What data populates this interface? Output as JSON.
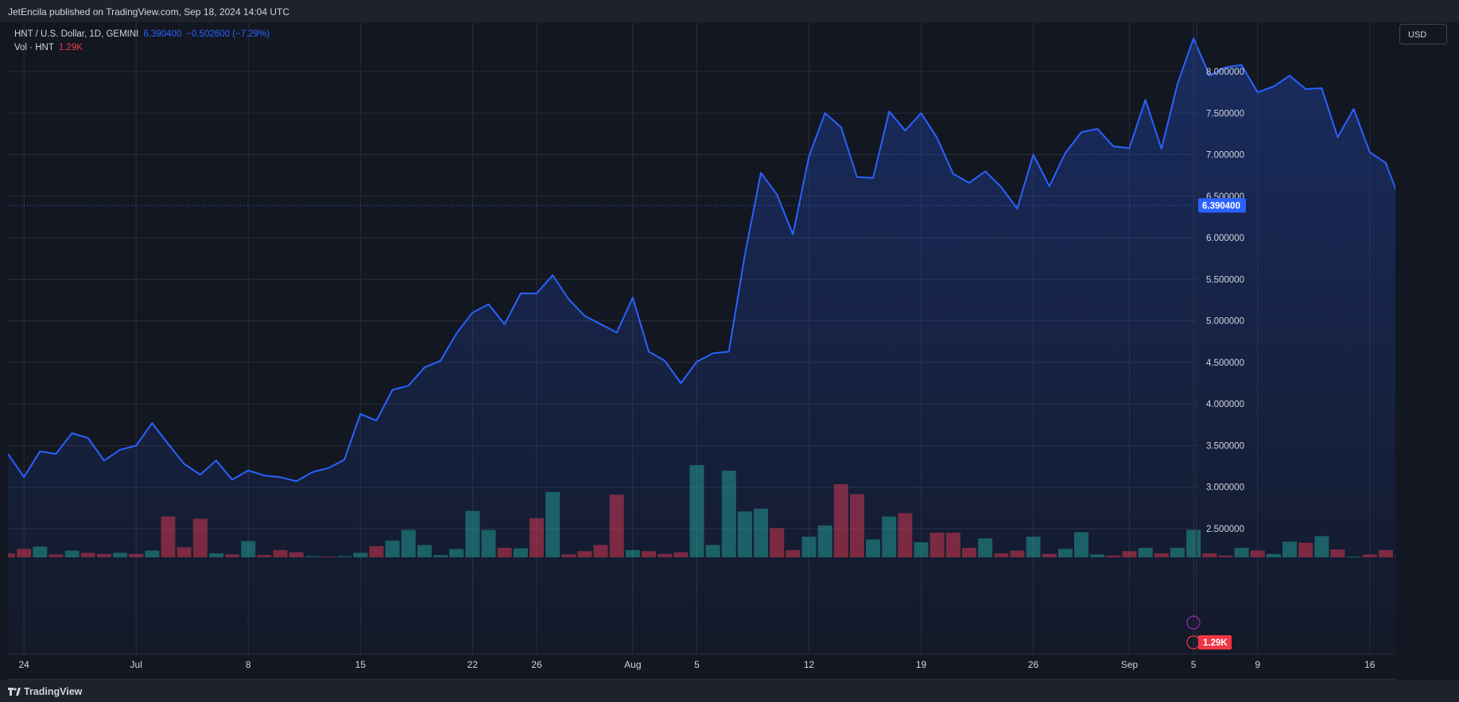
{
  "header": {
    "publisher": "JetEncila published on TradingView.com, Sep 18, 2024 14:04 UTC"
  },
  "legend": {
    "symbol": "HNT / U.S. Dollar, 1D, GEMINI",
    "price": "6.390400",
    "change": "−0.502600 (−7.29%)",
    "volume_label": "Vol · HNT",
    "volume_value": "1.29K"
  },
  "currency_button": "USD",
  "footer": {
    "brand": "TradingView"
  },
  "colors": {
    "line": "#2962ff",
    "up_volume": "#22ab94",
    "down_volume": "#f23645",
    "background": "#131722",
    "grid": "#2a2e39"
  },
  "chart_data": {
    "type": "area",
    "title": "",
    "xlabel": "",
    "ylabel": "",
    "ylim": [
      2.0,
      8.5
    ],
    "y_ticks": [
      2.5,
      3.0,
      3.5,
      4.0,
      4.5,
      5.0,
      5.5,
      6.0,
      6.5,
      7.0,
      7.5,
      8.0
    ],
    "y_tick_labels": [
      "2.500000",
      "3.000000",
      "3.500000",
      "4.000000",
      "4.500000",
      "5.000000",
      "5.500000",
      "6.000000",
      "6.500000",
      "7.000000",
      "7.500000",
      "8.000000"
    ],
    "x": [
      "2024-06-23",
      "2024-06-24",
      "2024-06-25",
      "2024-06-26",
      "2024-06-27",
      "2024-06-28",
      "2024-06-29",
      "2024-06-30",
      "2024-07-01",
      "2024-07-02",
      "2024-07-03",
      "2024-07-04",
      "2024-07-05",
      "2024-07-06",
      "2024-07-07",
      "2024-07-08",
      "2024-07-09",
      "2024-07-10",
      "2024-07-11",
      "2024-07-12",
      "2024-07-13",
      "2024-07-14",
      "2024-07-15",
      "2024-07-16",
      "2024-07-17",
      "2024-07-18",
      "2024-07-19",
      "2024-07-20",
      "2024-07-21",
      "2024-07-22",
      "2024-07-23",
      "2024-07-24",
      "2024-07-25",
      "2024-07-26",
      "2024-07-27",
      "2024-07-28",
      "2024-07-29",
      "2024-07-30",
      "2024-07-31",
      "2024-08-01",
      "2024-08-02",
      "2024-08-03",
      "2024-08-04",
      "2024-08-05",
      "2024-08-06",
      "2024-08-07",
      "2024-08-08",
      "2024-08-09",
      "2024-08-10",
      "2024-08-11",
      "2024-08-12",
      "2024-08-13",
      "2024-08-14",
      "2024-08-15",
      "2024-08-16",
      "2024-08-17",
      "2024-08-18",
      "2024-08-19",
      "2024-08-20",
      "2024-08-21",
      "2024-08-22",
      "2024-08-23",
      "2024-08-24",
      "2024-08-25",
      "2024-08-26",
      "2024-08-27",
      "2024-08-28",
      "2024-08-29",
      "2024-08-30",
      "2024-08-31",
      "2024-09-01",
      "2024-09-02",
      "2024-09-03",
      "2024-09-04",
      "2024-09-05",
      "2024-09-06",
      "2024-09-07",
      "2024-09-08",
      "2024-09-09",
      "2024-09-10",
      "2024-09-11",
      "2024-09-12",
      "2024-09-13",
      "2024-09-14",
      "2024-09-15",
      "2024-09-16",
      "2024-09-17",
      "2024-09-18"
    ],
    "x_ticks": [
      {
        "date": "2024-06-24",
        "label": "24"
      },
      {
        "date": "2024-07-01",
        "label": "Jul"
      },
      {
        "date": "2024-07-08",
        "label": "8"
      },
      {
        "date": "2024-07-15",
        "label": "15"
      },
      {
        "date": "2024-07-22",
        "label": "22"
      },
      {
        "date": "2024-07-26",
        "label": "26"
      },
      {
        "date": "2024-08-01",
        "label": "Aug"
      },
      {
        "date": "2024-08-05",
        "label": "5"
      },
      {
        "date": "2024-08-12",
        "label": "12"
      },
      {
        "date": "2024-08-19",
        "label": "19"
      },
      {
        "date": "2024-08-26",
        "label": "26"
      },
      {
        "date": "2024-09-01",
        "label": "Sep"
      },
      {
        "date": "2024-09-05",
        "label": "5"
      },
      {
        "date": "2024-09-09",
        "label": "9"
      },
      {
        "date": "2024-09-16",
        "label": "16"
      }
    ],
    "series": [
      {
        "name": "HNT / U.S. Dollar",
        "values": [
          3.4,
          3.12,
          3.43,
          3.4,
          3.65,
          3.59,
          3.32,
          3.45,
          3.5,
          3.77,
          3.52,
          3.28,
          3.15,
          3.32,
          3.09,
          3.2,
          3.14,
          3.12,
          3.07,
          3.18,
          3.23,
          3.33,
          3.88,
          3.8,
          4.17,
          4.22,
          4.44,
          4.52,
          4.85,
          5.1,
          5.2,
          4.96,
          5.33,
          5.33,
          5.55,
          5.26,
          5.06,
          4.96,
          4.86,
          5.28,
          4.63,
          4.52,
          4.25,
          4.51,
          4.61,
          4.63,
          5.8,
          6.78,
          6.52,
          6.04,
          6.98,
          7.5,
          7.33,
          6.73,
          6.72,
          7.52,
          7.29,
          7.5,
          7.2,
          6.77,
          6.66,
          6.8,
          6.61,
          6.35,
          7.0,
          6.62,
          7.02,
          7.27,
          7.31,
          7.1,
          7.08,
          7.66,
          7.07,
          7.85,
          8.4,
          7.95,
          8.05,
          8.08,
          7.75,
          7.82,
          7.95,
          7.79,
          7.8,
          7.21,
          7.55,
          7.03,
          6.9,
          6.39
        ]
      },
      {
        "name": "Vol · HNT",
        "values": [
          0.07,
          0.15,
          0.19,
          0.05,
          0.12,
          0.08,
          0.06,
          0.08,
          0.06,
          0.12,
          0.73,
          0.18,
          0.69,
          0.07,
          0.05,
          0.29,
          0.04,
          0.13,
          0.09,
          0.02,
          0.01,
          0.02,
          0.08,
          0.2,
          0.3,
          0.49,
          0.22,
          0.04,
          0.15,
          0.83,
          0.49,
          0.17,
          0.16,
          0.7,
          1.17,
          0.05,
          0.11,
          0.22,
          1.12,
          0.13,
          0.11,
          0.06,
          0.09,
          1.65,
          0.22,
          1.55,
          0.82,
          0.87,
          0.52,
          0.13,
          0.37,
          0.57,
          1.31,
          1.13,
          0.32,
          0.73,
          0.79,
          0.27,
          0.44,
          0.44,
          0.17,
          0.34,
          0.07,
          0.12,
          0.37,
          0.06,
          0.15,
          0.45,
          0.05,
          0.03,
          0.11,
          0.17,
          0.07,
          0.17,
          0.49,
          0.07,
          0.03,
          0.17,
          0.12,
          0.06,
          0.28,
          0.26,
          0.38,
          0.14,
          0.01,
          0.05,
          0.13,
          0.03
        ],
        "up": [
          0,
          0,
          1,
          0,
          1,
          0,
          0,
          1,
          0,
          1,
          0,
          0,
          0,
          1,
          0,
          1,
          0,
          0,
          0,
          1,
          0,
          1,
          1,
          0,
          1,
          1,
          1,
          1,
          1,
          1,
          1,
          0,
          1,
          0,
          1,
          0,
          0,
          0,
          0,
          1,
          0,
          0,
          0,
          1,
          1,
          1,
          1,
          1,
          0,
          0,
          1,
          1,
          0,
          0,
          1,
          1,
          0,
          1,
          0,
          0,
          0,
          1,
          0,
          0,
          1,
          0,
          1,
          1,
          1,
          0,
          0,
          1,
          0,
          1,
          1,
          0,
          0,
          1,
          0,
          1,
          1,
          0,
          1,
          0,
          1,
          0,
          0,
          0
        ]
      }
    ],
    "last_price_label": "6.390400",
    "last_volume_label": "1.29K",
    "grid": true
  }
}
